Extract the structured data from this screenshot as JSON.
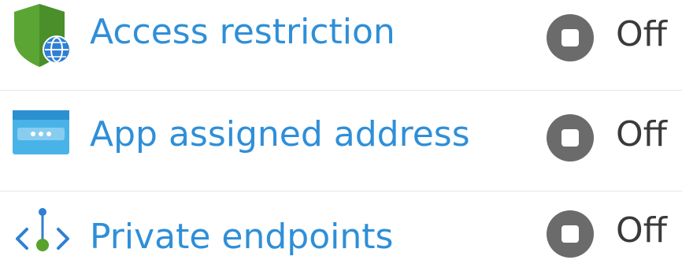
{
  "items": [
    {
      "label": "Access restriction",
      "status": "Off",
      "icon": "shield-globe-icon"
    },
    {
      "label": "App assigned address",
      "status": "Off",
      "icon": "app-address-icon"
    },
    {
      "label": "Private endpoints",
      "status": "Off",
      "icon": "private-endpoint-icon"
    }
  ],
  "colors": {
    "link": "#2f8fd8",
    "status_icon": "#6b6b6b",
    "status_text": "#3a3a3a",
    "divider": "#e6e6e6",
    "shield": "#4f9b2f",
    "globe": "#2f7fd3",
    "app_icon": "#49b3e8",
    "endpoint_green": "#57a32c",
    "endpoint_blue": "#2f7fd3"
  }
}
